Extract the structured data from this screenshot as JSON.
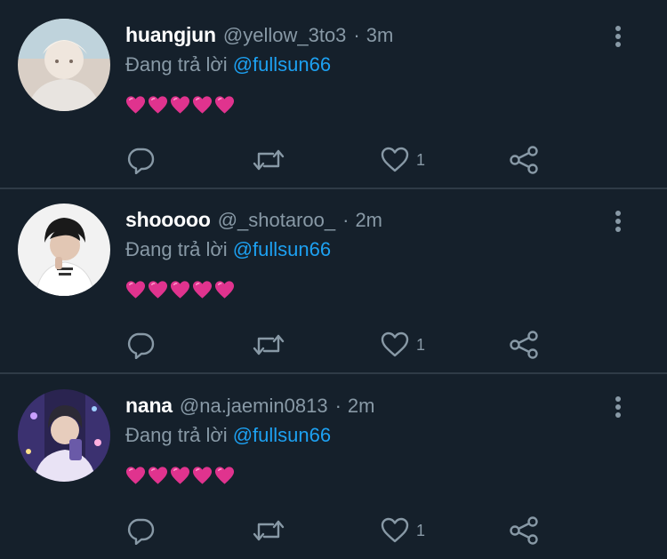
{
  "replies": [
    {
      "name": "huangjun",
      "handle": "@yellow_3to3",
      "separator": "·",
      "time": "3m",
      "replying_prefix": "Đang trả lời",
      "mention": "@fullsun66",
      "emoji": [
        "heart-emoji",
        "heart-emoji",
        "heart-emoji",
        "heart-emoji",
        "heart-emoji"
      ],
      "like_count": "1",
      "avatar_colors": [
        "#e8e4e0",
        "#d9cfc6",
        "#bfd3dc"
      ]
    },
    {
      "name": "shooooo",
      "handle": "@_shotaroo_",
      "separator": "·",
      "time": "2m",
      "replying_prefix": "Đang trả lời",
      "mention": "@fullsun66",
      "emoji": [
        "heart-emoji",
        "heart-emoji",
        "heart-emoji",
        "heart-emoji",
        "heart-emoji"
      ],
      "like_count": "1",
      "avatar_colors": [
        "#f2f2f2",
        "#1a1a1a",
        "#ffffff"
      ]
    },
    {
      "name": "nana",
      "handle": "@na.jaemin0813",
      "separator": "·",
      "time": "2m",
      "replying_prefix": "Đang trả lời",
      "mention": "@fullsun66",
      "emoji": [
        "heart-emoji",
        "heart-emoji",
        "heart-emoji",
        "heart-emoji",
        "heart-emoji"
      ],
      "like_count": "1",
      "avatar_colors": [
        "#2a2450",
        "#6a5aa8",
        "#e9e3f5"
      ]
    }
  ],
  "icons": {
    "reply": "reply-icon",
    "retweet": "retweet-icon",
    "like": "like-icon",
    "share": "share-icon",
    "more": "more-options-icon"
  },
  "colors": {
    "background": "#15202b",
    "divider": "#2f3b47",
    "name": "#ffffff",
    "secondary": "#8899a6",
    "mention": "#1da1f2",
    "heart": "#e0338e"
  }
}
